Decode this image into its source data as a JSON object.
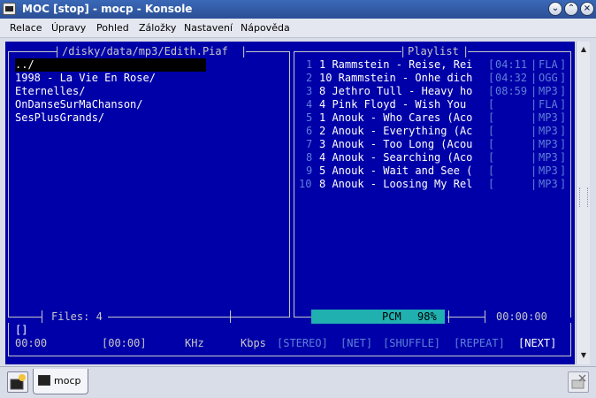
{
  "window": {
    "title": "MOC [stop] - mocp - Konsole"
  },
  "menu": [
    "Relace",
    "Úpravy",
    "Pohled",
    "Záložky",
    "Nastavení",
    "Nápověda"
  ],
  "browser": {
    "path": "/disky/data/mp3/Edith.Piaf",
    "items": [
      "../",
      "1998 - La Vie En Rose/",
      "Eternelles/",
      "OnDanseSurMaChanson/",
      "SesPlusGrands/"
    ],
    "files_label": "Files: 4"
  },
  "playlist": {
    "title": "Playlist",
    "rows": [
      {
        "num": "1",
        "text": "1 Rammstein - Reise, Rei",
        "time": "04:11",
        "fmt": "FLA"
      },
      {
        "num": "2",
        "text": "10 Rammstein - Onhe dich",
        "time": "04:32",
        "fmt": "OGG"
      },
      {
        "num": "3",
        "text": "8 Jethro Tull - Heavy ho",
        "time": "08:59",
        "fmt": "MP3"
      },
      {
        "num": "4",
        "text": "4 Pink Floyd - Wish You ",
        "time": "",
        "fmt": "FLA"
      },
      {
        "num": "5",
        "text": "1 Anouk - Who Cares (Aco",
        "time": "",
        "fmt": "MP3"
      },
      {
        "num": "6",
        "text": "2 Anouk - Everything (Ac",
        "time": "",
        "fmt": "MP3"
      },
      {
        "num": "7",
        "text": "3 Anouk - Too Long (Acou",
        "time": "",
        "fmt": "MP3"
      },
      {
        "num": "8",
        "text": "4 Anouk - Searching (Aco",
        "time": "",
        "fmt": "MP3"
      },
      {
        "num": "9",
        "text": "5 Anouk - Wait and See (",
        "time": "",
        "fmt": "MP3"
      },
      {
        "num": "10",
        "text": "8 Anouk - Loosing My Rel",
        "time": "",
        "fmt": "MP3"
      }
    ]
  },
  "status": {
    "pcm_label": "PCM",
    "pcm_value": "98%",
    "pcm_fill": 0.98,
    "total_time": "00:00:00",
    "line_text": "[]",
    "time_pos": "00:00",
    "time_total": "[00:00]",
    "khz": "KHz",
    "kbps": "Kbps",
    "flags": [
      {
        "label": "[STEREO]",
        "active": false
      },
      {
        "label": "[NET]",
        "active": false
      },
      {
        "label": "[SHUFFLE]",
        "active": false
      },
      {
        "label": "[REPEAT]",
        "active": false
      },
      {
        "label": "[NEXT]",
        "active": true
      }
    ]
  },
  "tabs": [
    {
      "label": "mocp"
    }
  ],
  "colors": {
    "terminal_bg": "#0000a8",
    "mixer_fill": "#20b0b0"
  }
}
